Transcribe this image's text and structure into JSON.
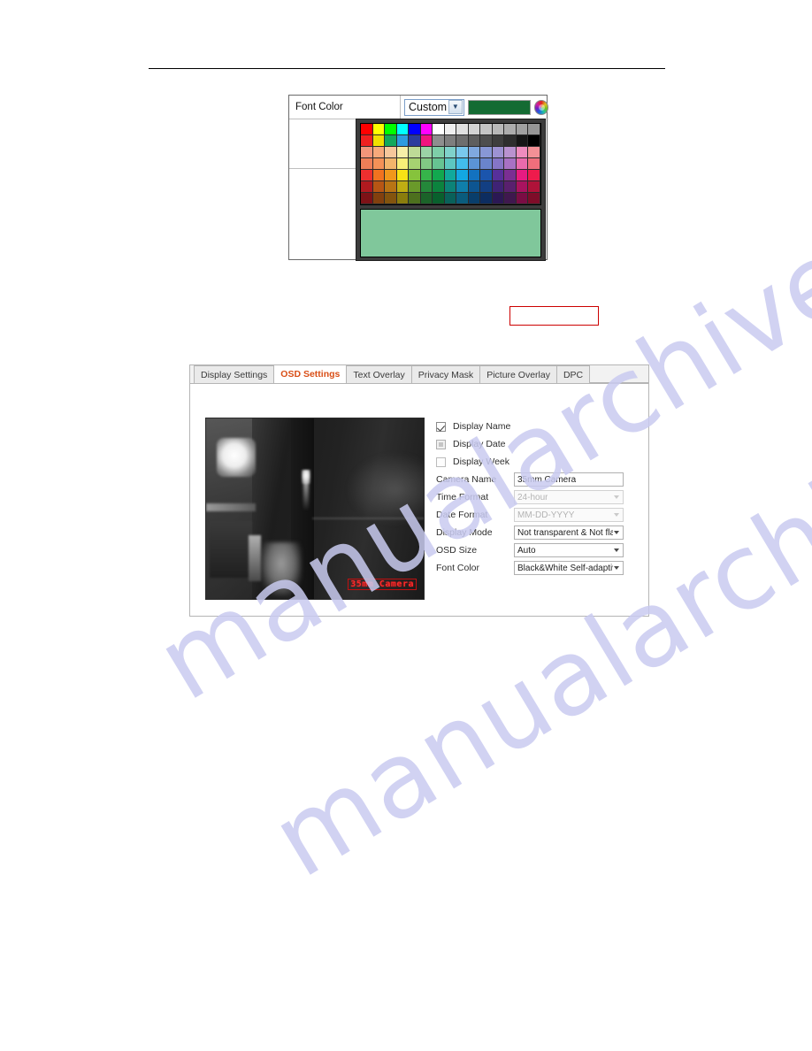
{
  "font_color_dialog": {
    "row_label": "Font Color",
    "mode_select": {
      "value": "Custom",
      "caret_glyph": "⌄"
    },
    "current_color_hex": "#146B33",
    "color_wheel_icon": "color-wheel-icon",
    "preview_color_hex": "#80C79B",
    "palette": {
      "columns": 15,
      "rows": 7,
      "colors": [
        [
          "#FF0000",
          "#FFFF00",
          "#00FF00",
          "#00FFFF",
          "#0000FF",
          "#FF00FF",
          "#FFFFFF",
          "#EFEFEF",
          "#E0E0E0",
          "#D2D2D2",
          "#C4C4C4",
          "#B8B8B8",
          "#ACACAC",
          "#A0A0A0",
          "#969696"
        ],
        [
          "#F02020",
          "#F0E000",
          "#12A85C",
          "#2D9BE0",
          "#2B3C9E",
          "#F0137E",
          "#8E8E8E",
          "#7E7E7E",
          "#6E6E6E",
          "#5E5E5E",
          "#4E4E4E",
          "#3E3E3E",
          "#2E2E2E",
          "#161616",
          "#000000"
        ],
        [
          "#F2957A",
          "#F7A97B",
          "#F6C79B",
          "#F6EFA8",
          "#BEDB97",
          "#9BD3A6",
          "#7ECFA8",
          "#7FD2CB",
          "#79C9EE",
          "#7FA8DF",
          "#8897D5",
          "#9D92D2",
          "#B992D0",
          "#EE8CBE",
          "#F39096"
        ],
        [
          "#EF7E57",
          "#F49157",
          "#F2B56B",
          "#F7EE78",
          "#A6D271",
          "#81C984",
          "#66C392",
          "#5CC6C1",
          "#42BDEC",
          "#5B94D6",
          "#6A84CC",
          "#8575C6",
          "#A871C3",
          "#EA6AAC",
          "#F06E7C"
        ],
        [
          "#EE2F2F",
          "#F1721F",
          "#F0971B",
          "#F7E215",
          "#86C33C",
          "#36B44A",
          "#12A84F",
          "#11A99C",
          "#13A7E2",
          "#1372C0",
          "#1B55AD",
          "#57309B",
          "#7B2E93",
          "#E61B81",
          "#EE1B4C"
        ],
        [
          "#B01A1F",
          "#B75614",
          "#B87414",
          "#BFAE13",
          "#6A9A2A",
          "#24883A",
          "#0C833E",
          "#0C8378",
          "#0F7FAB",
          "#0D5591",
          "#133F83",
          "#3F2375",
          "#59206E",
          "#A9135F",
          "#B01339"
        ],
        [
          "#7E1217",
          "#82400E",
          "#83540E",
          "#8A7D0D",
          "#4D701E",
          "#1B6329",
          "#09602D",
          "#09615A",
          "#0A5C7D",
          "#093E6B",
          "#0D2D60",
          "#2B1854",
          "#3F184E",
          "#7A0D44",
          "#7E0D29"
        ]
      ]
    }
  },
  "red_annotation": {
    "name": "red-callout-box",
    "border_color": "#CC0000",
    "text": ""
  },
  "osd_panel": {
    "tabs": [
      {
        "label": "Display Settings",
        "active": false
      },
      {
        "label": "OSD Settings",
        "active": true
      },
      {
        "label": "Text Overlay",
        "active": false
      },
      {
        "label": "Privacy Mask",
        "active": false
      },
      {
        "label": "Picture Overlay",
        "active": false
      },
      {
        "label": "DPC",
        "active": false
      }
    ],
    "active_tab_color": "#D94F17",
    "video_preview": {
      "osd_overlay_text": "35mm Camera",
      "osd_text_color": "#FF2B2B"
    },
    "checkboxes": [
      {
        "label": "Display Name",
        "state": "checked"
      },
      {
        "label": "Display Date",
        "state": "partial"
      },
      {
        "label": "Display Week",
        "state": "empty"
      }
    ],
    "fields": [
      {
        "label": "Camera Name",
        "value": "35mm Camera",
        "type": "text",
        "disabled": false
      },
      {
        "label": "Time Format",
        "value": "24-hour",
        "type": "select",
        "disabled": true
      },
      {
        "label": "Date Format",
        "value": "MM-DD-YYYY",
        "type": "select",
        "disabled": true
      },
      {
        "label": "Display Mode",
        "value": "Not transparent & Not flashir",
        "type": "select",
        "disabled": false
      },
      {
        "label": "OSD Size",
        "value": "Auto",
        "type": "select",
        "disabled": false
      },
      {
        "label": "Font Color",
        "value": "Black&White Self-adaptive",
        "type": "select",
        "disabled": false
      }
    ]
  },
  "watermark": {
    "line1": "manualarchive.com",
    "line2": "manualarchive.com",
    "color": "#C9CBF0"
  }
}
